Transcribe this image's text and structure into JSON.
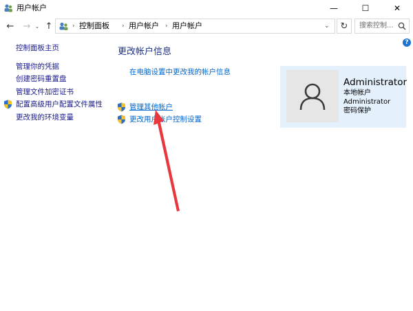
{
  "window": {
    "title": "用户帐户",
    "minimize_glyph": "—",
    "maximize_glyph": "☐",
    "close_glyph": "✕"
  },
  "navigation": {
    "back_glyph": "←",
    "forward_glyph": "→",
    "recent_glyph": "⌄",
    "up_glyph": "↑",
    "breadcrumbs": [
      "控制面板",
      "用户帐户",
      "用户帐户"
    ],
    "separator": "›",
    "dropdown_glyph": "⌄",
    "refresh_glyph": "↻",
    "search_placeholder": "搜索控制..."
  },
  "help": {
    "label": "?"
  },
  "sidebar": {
    "items": [
      {
        "label": "控制面板主页",
        "icon": ""
      },
      {
        "label": "管理你的凭据",
        "icon": ""
      },
      {
        "label": "创建密码重置盘",
        "icon": ""
      },
      {
        "label": "管理文件加密证书",
        "icon": ""
      },
      {
        "label": "配置高级用户配置文件属性",
        "icon": "uac-shield-icon"
      },
      {
        "label": "更改我的环境变量",
        "icon": ""
      }
    ]
  },
  "main": {
    "heading": "更改帐户信息",
    "links": [
      {
        "label": "在电脑设置中更改我的帐户信息",
        "icon": ""
      },
      {
        "label": "管理其他帐户",
        "icon": "uac-shield-icon"
      },
      {
        "label": "更改用户帐户控制设置",
        "icon": "uac-shield-icon"
      }
    ]
  },
  "account": {
    "name": "Administrator",
    "type": "本地帐户",
    "group": "Administrator",
    "password_status": "密码保护"
  },
  "colors": {
    "link": "#0066cc",
    "heading": "#1e3287",
    "card_bg": "#e4f0fb",
    "annotation_arrow": "#e8383d"
  }
}
